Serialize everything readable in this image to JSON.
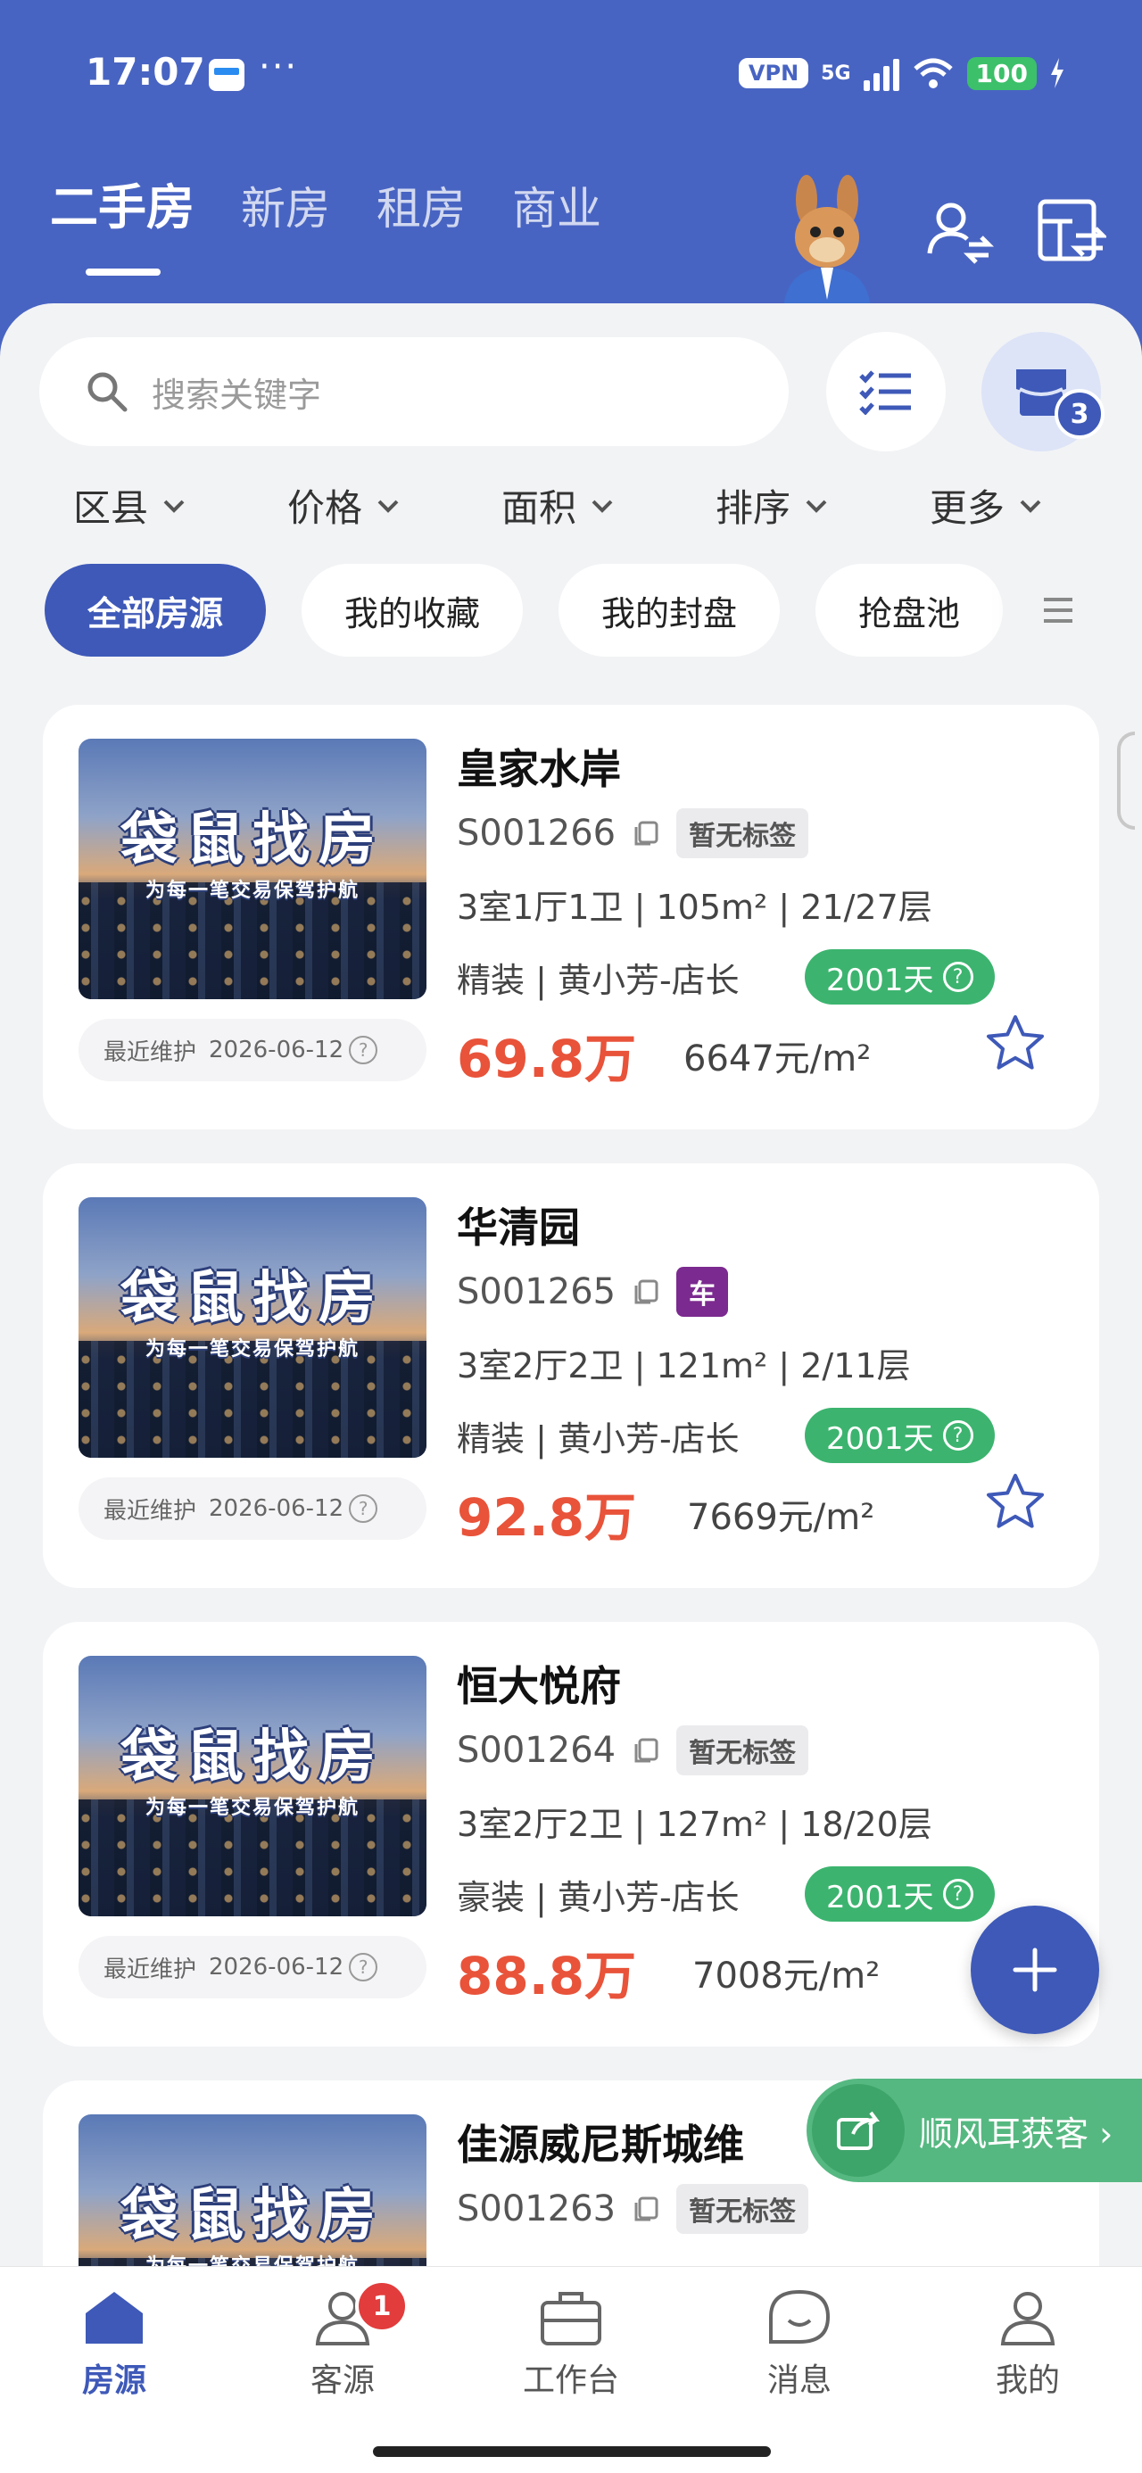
{
  "status_bar": {
    "time": "17:07",
    "dots": "···",
    "vpn": "VPN",
    "network": "5G",
    "battery": "100"
  },
  "top_tabs": [
    {
      "label": "二手房",
      "active": true
    },
    {
      "label": "新房",
      "active": false
    },
    {
      "label": "租房",
      "active": false
    },
    {
      "label": "商业",
      "active": false
    }
  ],
  "search": {
    "placeholder": "搜索关键字"
  },
  "store_badge": "3",
  "filters": [
    "区县",
    "价格",
    "面积",
    "排序",
    "更多"
  ],
  "chips": [
    {
      "label": "全部房源",
      "active": true
    },
    {
      "label": "我的收藏",
      "active": false
    },
    {
      "label": "我的封盘",
      "active": false
    },
    {
      "label": "抢盘池",
      "active": false
    }
  ],
  "listings": [
    {
      "img_title": "袋鼠找房",
      "img_sub": "为每一笔交易保驾护航",
      "maint_label": "最近维护",
      "maint_date": "2026-06-12",
      "title": "皇家水岸",
      "code": "S001266",
      "tag": "暂无标签",
      "tag_type": "default",
      "specs": "3室1厅1卫 | 105m² | 21/27层",
      "decor": "精装 | 黄小芳-店长",
      "days": "2001天",
      "price": "69.8万",
      "unit_price": "6647元/m²"
    },
    {
      "img_title": "袋鼠找房",
      "img_sub": "为每一笔交易保驾护航",
      "maint_label": "最近维护",
      "maint_date": "2026-06-12",
      "title": "华清园",
      "code": "S001265",
      "tag": "车",
      "tag_type": "car",
      "specs": "3室2厅2卫 | 121m² | 2/11层",
      "decor": "精装 | 黄小芳-店长",
      "days": "2001天",
      "price": "92.8万",
      "unit_price": "7669元/m²"
    },
    {
      "img_title": "袋鼠找房",
      "img_sub": "为每一笔交易保驾护航",
      "maint_label": "最近维护",
      "maint_date": "2026-06-12",
      "title": "恒大悦府",
      "code": "S001264",
      "tag": "暂无标签",
      "tag_type": "default",
      "specs": "3室2厅2卫 | 127m² | 18/20层",
      "decor": "豪装 | 黄小芳-店长",
      "days": "2001天",
      "price": "88.8万",
      "unit_price": "7008元/m²"
    },
    {
      "img_title": "袋鼠找房",
      "img_sub": "为每一笔交易保驾护航",
      "title": "佳源威尼斯城维",
      "code": "S001263",
      "tag": "暂无标签",
      "tag_type": "default"
    }
  ],
  "promo": {
    "label": "顺风耳获客 ›"
  },
  "bottom_nav": [
    {
      "label": "房源",
      "active": true
    },
    {
      "label": "客源",
      "active": false,
      "badge": "1"
    },
    {
      "label": "工作台",
      "active": false
    },
    {
      "label": "消息",
      "active": false
    },
    {
      "label": "我的",
      "active": false
    }
  ],
  "colors": {
    "brand": "#4864c2",
    "accent": "#3e59b8",
    "price": "#e8533a",
    "days": "#3cb46f",
    "car_tag": "#7b2a8f"
  }
}
